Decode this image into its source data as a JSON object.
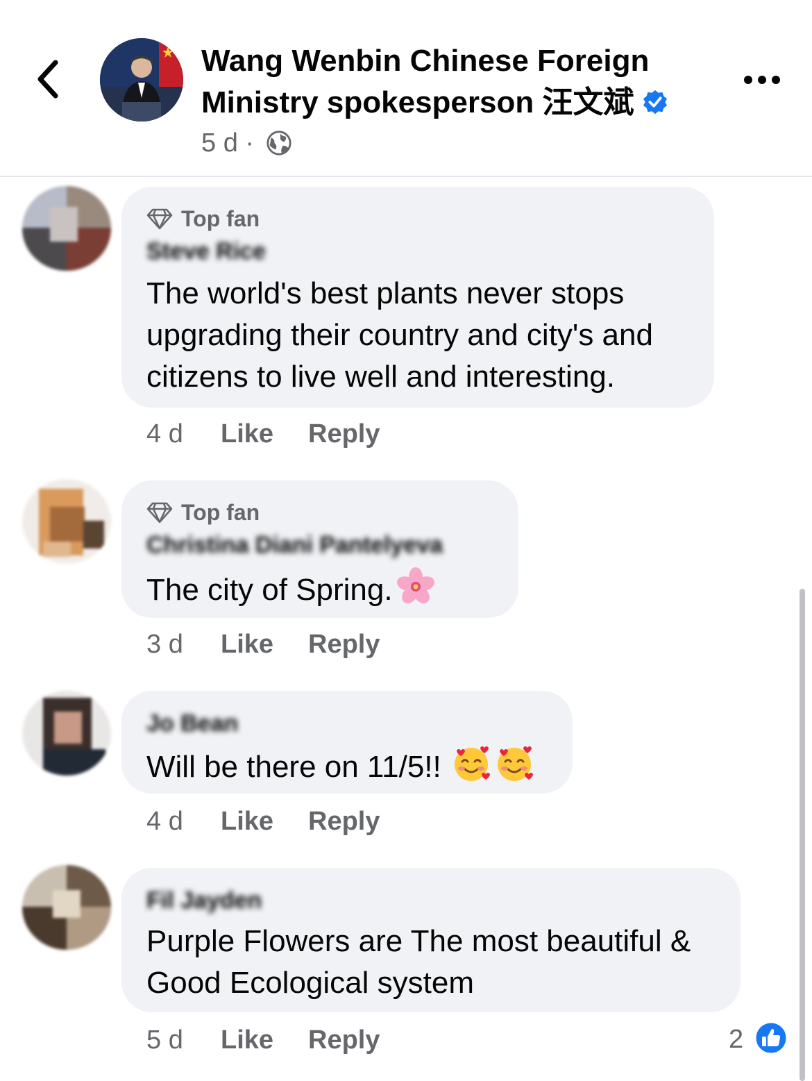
{
  "header": {
    "title": "Wang Wenbin Chinese Foreign Ministry spokesperson 汪文斌",
    "time": "5 d",
    "separator": "·"
  },
  "comments": [
    {
      "badge": "Top fan",
      "author": "Steve Rice",
      "lines": [
        "The world's best plants never stops",
        "upgrading their country and city's and",
        "citizens to live well and interesting."
      ],
      "time": "4 d",
      "like": "Like",
      "reply": "Reply"
    },
    {
      "badge": "Top fan",
      "author": "Christina Diani Pantelyeva",
      "lines": [
        "The city of Spring."
      ],
      "time": "3 d",
      "like": "Like",
      "reply": "Reply"
    },
    {
      "author": "Jo Bean",
      "lines": [
        "Will be there on 11/5!!"
      ],
      "time": "4 d",
      "like": "Like",
      "reply": "Reply"
    },
    {
      "author": "Fil Jayden",
      "lines": [
        "Purple Flowers are The most beautiful &",
        "Good Ecological system"
      ],
      "time": "5 d",
      "like": "Like",
      "reply": "Reply",
      "reactions": "2"
    }
  ],
  "colors": {
    "accent": "#1877f2",
    "bubble": "#f0f2f5",
    "secondary_text": "#65676b"
  },
  "icons": [
    "back-chevron-icon",
    "verified-badge-icon",
    "globe-icon",
    "more-options-icon",
    "diamond-icon",
    "cherry-blossom-emoji",
    "smiling-face-with-hearts-emoji",
    "like-reaction-icon"
  ]
}
